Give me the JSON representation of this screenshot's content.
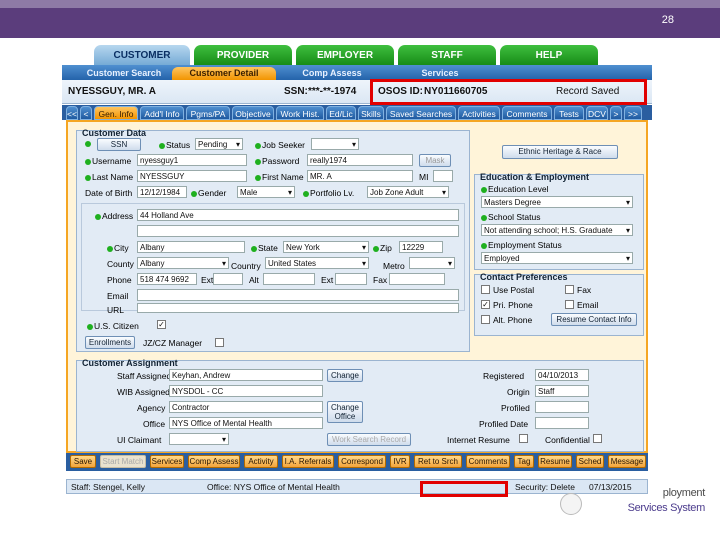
{
  "slide": {
    "page_number": "28"
  },
  "tabs_main": [
    "CUSTOMER",
    "PROVIDER",
    "EMPLOYER",
    "STAFF",
    "HELP"
  ],
  "tabs_sub": [
    "Customer Search",
    "Customer Detail",
    "Comp Assess",
    "Services"
  ],
  "header": {
    "name": "NYESSGUY, MR. A",
    "ssn_label": "SSN:",
    "ssn_value": "***-**-1974",
    "osos_label": "OSOS ID:",
    "osos_value": "NY011660705",
    "record_saved": "Record Saved"
  },
  "tabs_profile": [
    "<<",
    "<",
    "Gen. Info",
    "Add'l Info",
    "Pgms/PA",
    "Objective",
    "Work Hist.",
    "Ed/Lic",
    "Skills",
    "Saved Searches",
    "Activities",
    "Comments",
    "Tests",
    "DCV",
    ">",
    ">>"
  ],
  "customer_data": {
    "title": "Customer Data",
    "ssn_button": "SSN",
    "status_label": "Status",
    "status_value": "Pending",
    "job_seeker_label": "Job Seeker",
    "job_seeker_value": "",
    "username_label": "Username",
    "username_value": "nyessguy1",
    "password_label": "Password",
    "password_value": "really1974",
    "mask_button": "Mask",
    "last_name_label": "Last Name",
    "last_name_value": "NYESSGUY",
    "first_name_label": "First Name",
    "first_name_value": "MR. A",
    "mi_label": "MI",
    "dob_label": "Date of Birth",
    "dob_value": "12/12/1984",
    "gender_label": "Gender",
    "gender_value": "Male",
    "portfolio_label": "Portfolio Lv.",
    "portfolio_value": "Job Zone Adult",
    "address_label": "Address",
    "address_value": "44 Holland Ave",
    "city_label": "City",
    "city_value": "Albany",
    "state_label": "State",
    "state_value": "New York",
    "zip_label": "Zip",
    "zip_value": "12229",
    "county_label": "County",
    "county_value": "Albany",
    "country_label": "Country",
    "country_value": "United States",
    "metro_label": "Metro",
    "phone_label": "Phone",
    "phone_value": "518 474 9692",
    "ext_label": "Ext",
    "alt_label": "Alt",
    "alt_ext_label": "Ext",
    "fax_label": "Fax",
    "email_label": "Email",
    "url_label": "URL",
    "us_citizen_label": "U.S. Citizen",
    "us_citizen_mark": "✓",
    "enrollments_button": "Enrollments",
    "jzcz_label": "JZ/CZ Manager"
  },
  "ethnic_button": "Ethnic Heritage & Race",
  "education": {
    "title": "Education & Employment",
    "edu_level_label": "Education Level",
    "edu_level_value": "Masters Degree",
    "school_status_label": "School Status",
    "school_status_value": "Not attending school; H.S. Graduate",
    "emp_status_label": "Employment Status",
    "emp_status_value": "Employed"
  },
  "contact": {
    "title": "Contact Preferences",
    "use_postal": "Use Postal",
    "fax": "Fax",
    "pri_phone": "Pri. Phone",
    "pri_phone_mark": "✓",
    "email": "Email",
    "alt_phone": "Alt. Phone",
    "resume_button": "Resume Contact Info"
  },
  "assignment": {
    "title": "Customer Assignment",
    "staff_label": "Staff Assigned",
    "staff_value": "Keyhan, Andrew",
    "change_button": "Change",
    "wib_label": "WIB Assigned",
    "wib_value": "NYSDOL - CC",
    "agency_label": "Agency",
    "agency_value": "Contractor",
    "change_office_button": "Change Office",
    "office_label": "Office",
    "office_value": "NYS Office of Mental Health",
    "ui_label": "UI Claimant",
    "work_search_button": "Work Search Record",
    "registered_label": "Registered",
    "registered_value": "04/10/2013",
    "origin_label": "Origin",
    "origin_value": "Staff",
    "profiled_label": "Profiled",
    "profiled_date_label": "Profiled Date",
    "internet_resume_label": "Internet Resume",
    "confidential_label": "Confidential"
  },
  "bottom_buttons": [
    "Save",
    "Start Match",
    "Services",
    "Comp Assess",
    "Activity",
    "I.A. Referrals",
    "Correspond",
    "IVR",
    "Ret to Srch",
    "Comments",
    "Tag",
    "Resume",
    "Sched",
    "Message"
  ],
  "status": {
    "staff": "Staff: Stengel, Kelly",
    "office": "Office: NYS Office of Mental Health",
    "security": "Security: Delete",
    "date": "07/13/2015"
  },
  "logo": {
    "line1": "ployment",
    "line2": "Services System"
  }
}
